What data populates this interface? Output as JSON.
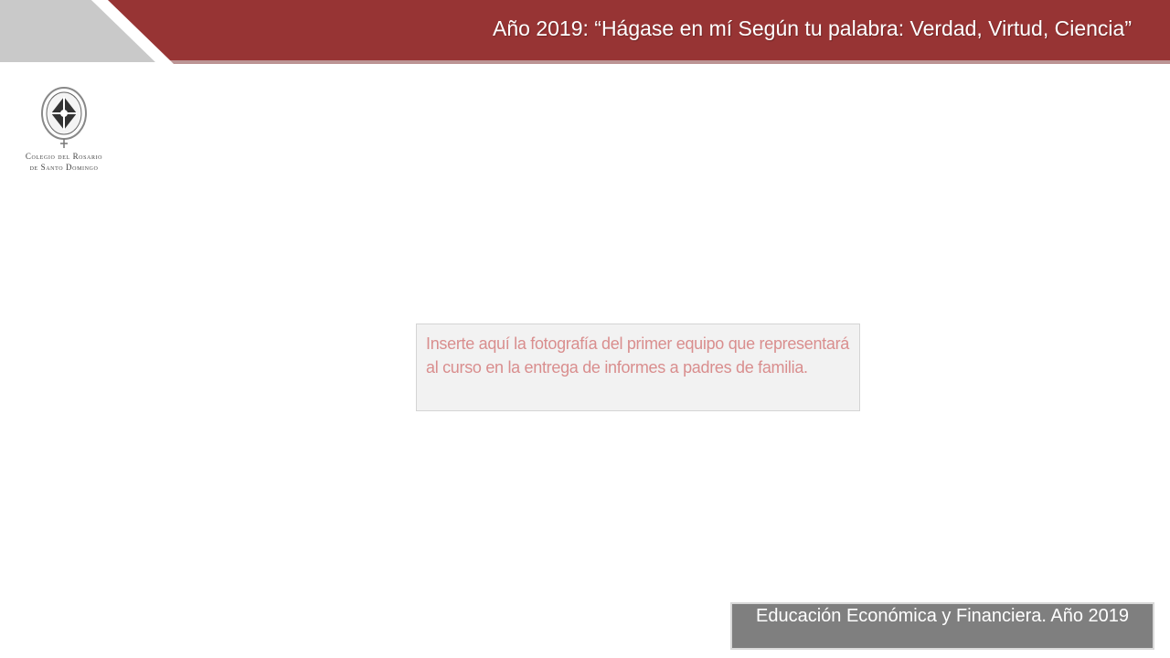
{
  "header": {
    "title": "Año 2019: “Hágase en mí Según tu palabra: Verdad, Virtud, Ciencia”"
  },
  "logo": {
    "line1": "Colegio del Rosario",
    "line2": "de Santo Domingo"
  },
  "placeholder": {
    "text": "Inserte aquí la fotografía del primer equipo que representará al curso en la entrega de informes a padres de familia."
  },
  "footer": {
    "text": "Educación Económica y Financiera. Año 2019"
  },
  "colors": {
    "banner_red": "#973434",
    "banner_gray": "#c9c9c9",
    "placeholder_text": "#d98e8e",
    "footer_bg": "#7f7f7f"
  }
}
